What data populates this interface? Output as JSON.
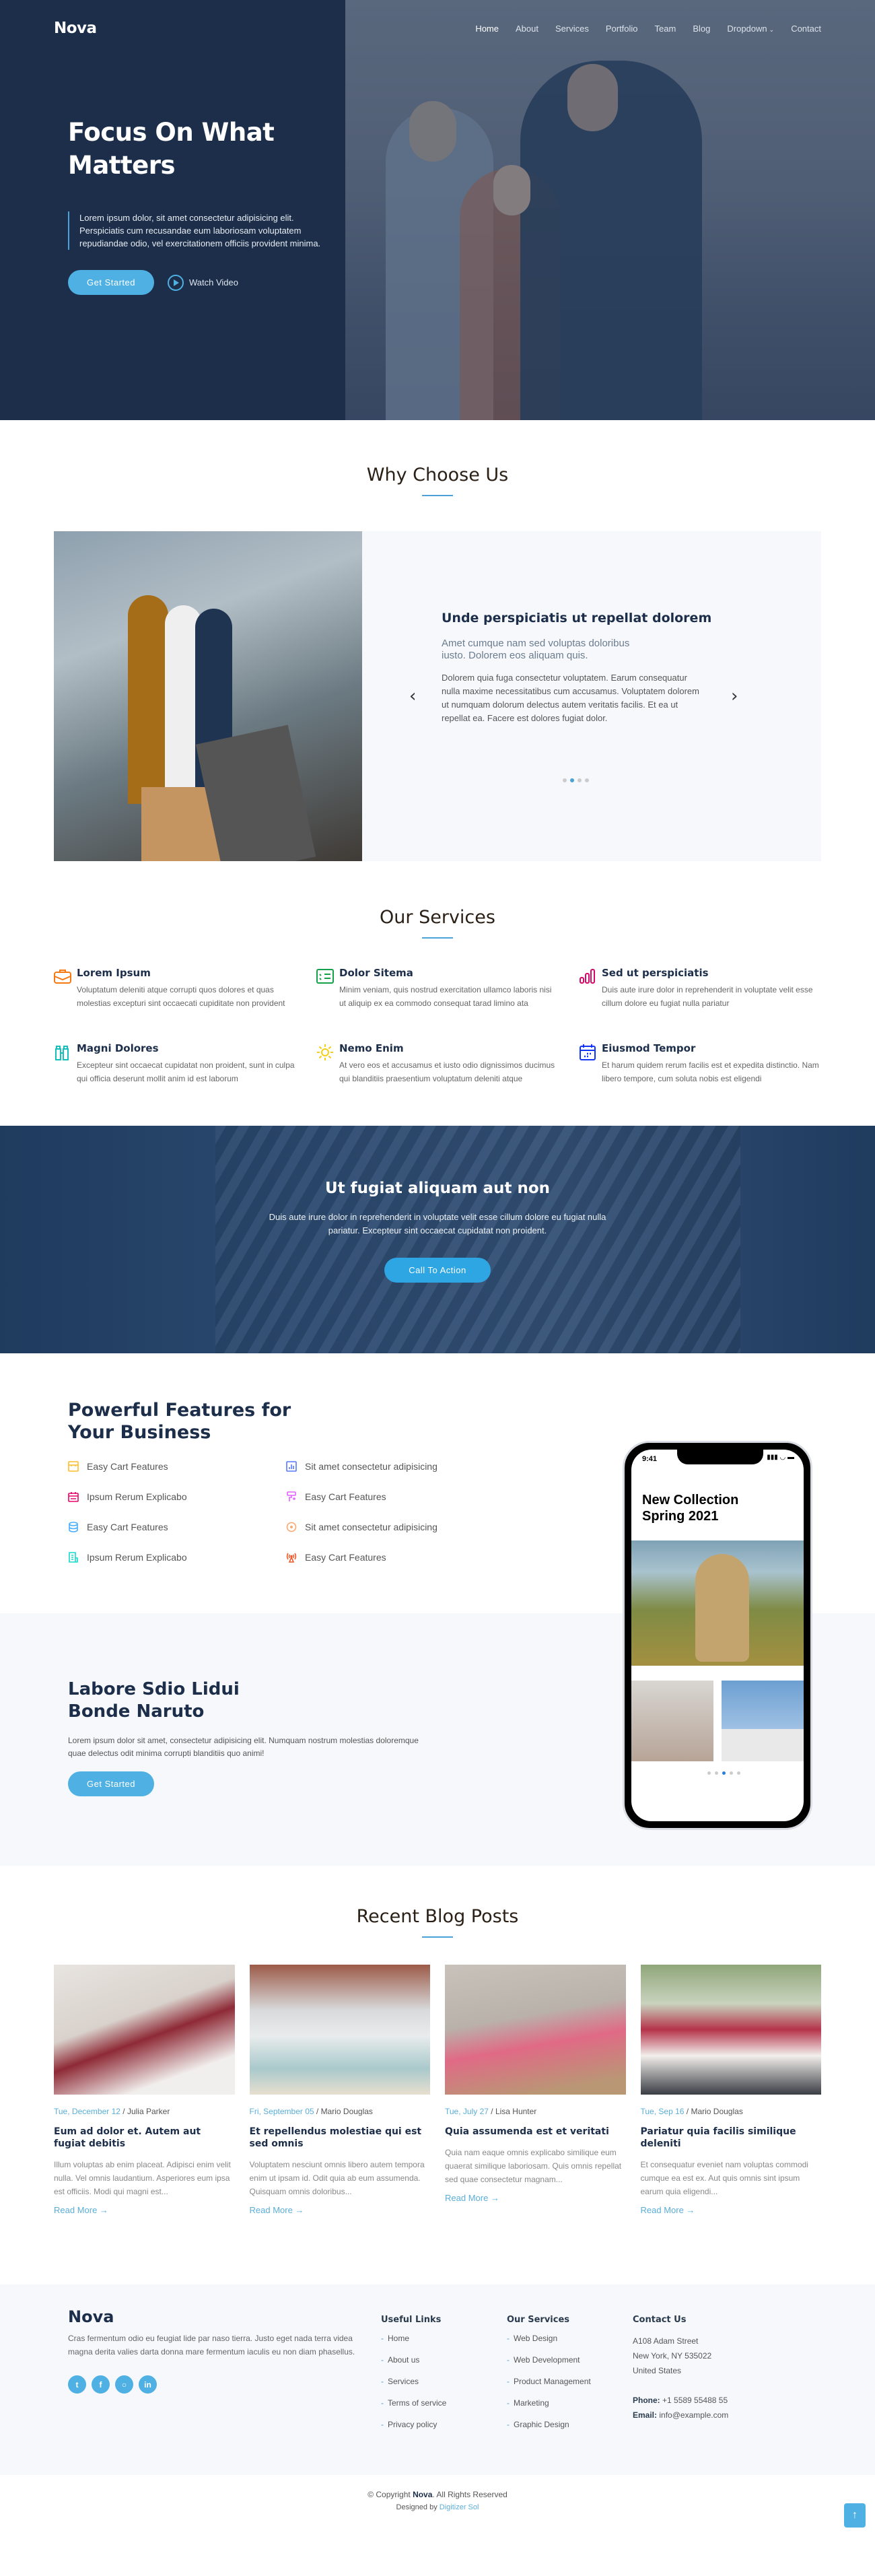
{
  "header": {
    "logo": "Nova",
    "nav": [
      {
        "label": "Home",
        "active": true
      },
      {
        "label": "About"
      },
      {
        "label": "Services"
      },
      {
        "label": "Portfolio"
      },
      {
        "label": "Team"
      },
      {
        "label": "Blog"
      },
      {
        "label": "Dropdown",
        "has_chevron": true
      },
      {
        "label": "Contact"
      }
    ]
  },
  "hero": {
    "title": "Focus On What Matters",
    "text": "Lorem ipsum dolor, sit amet consectetur adipisicing elit. Perspiciatis cum recusandae eum laboriosam voluptatem repudiandae odio, vel exercitationem officiis provident minima.",
    "cta_label": "Get Started",
    "video_label": "Watch Video"
  },
  "why": {
    "title": "Why Choose Us",
    "slide_title": "Unde perspiciatis ut repellat dolorem",
    "slide_subtitle": "Amet cumque nam sed voluptas doloribus iusto. Dolorem eos aliquam quis.",
    "slide_body": "Dolorem quia fuga consectetur voluptatem. Earum consequatur nulla maxime necessitatibus cum accusamus. Voluptatem dolorem ut numquam dolorum delectus autem veritatis facilis. Et ea ut repellat ea. Facere est dolores fugiat dolor.",
    "slide_count": 4,
    "active_slide": 2,
    "prev_icon": "chevron-left-icon",
    "next_icon": "chevron-right-icon"
  },
  "services": {
    "title": "Our Services",
    "items": [
      {
        "icon": "briefcase-icon",
        "color": "#f57813",
        "title": "Lorem Ipsum",
        "text": "Voluptatum deleniti atque corrupti quos dolores et quas molestias excepturi sint occaecati cupiditate non provident"
      },
      {
        "icon": "checklist-icon",
        "color": "#15a04a",
        "title": "Dolor Sitema",
        "text": "Minim veniam, quis nostrud exercitation ullamco laboris nisi ut aliquip ex ea commodo consequat tarad limino ata"
      },
      {
        "icon": "bar-chart-icon",
        "color": "#d90769",
        "title": "Sed ut perspiciatis",
        "text": "Duis aute irure dolor in reprehenderit in voluptate velit esse cillum dolore eu fugiat nulla pariatur"
      },
      {
        "icon": "binoculars-icon",
        "color": "#15bfbc",
        "title": "Magni Dolores",
        "text": "Excepteur sint occaecat cupidatat non proident, sunt in culpa qui officia deserunt mollit anim id est laborum"
      },
      {
        "icon": "sun-icon",
        "color": "#f5cf13",
        "title": "Nemo Enim",
        "text": "At vero eos et accusamus et iusto odio dignissimos ducimus qui blanditiis praesentium voluptatum deleniti atque"
      },
      {
        "icon": "calendar-icon",
        "color": "#1335f5",
        "title": "Eiusmod Tempor",
        "text": "Et harum quidem rerum facilis est et expedita distinctio. Nam libero tempore, cum soluta nobis est eligendi"
      }
    ]
  },
  "cta": {
    "title": "Ut fugiat aliquam aut non",
    "text": "Duis aute irure dolor in reprehenderit in voluptate velit esse cillum dolore eu fugiat nulla pariatur. Excepteur sint occaecat cupidatat non proident.",
    "button": "Call To Action"
  },
  "features": {
    "title": "Powerful Features for Your Business",
    "items": [
      {
        "icon": "store-icon",
        "color": "#ffbb2c",
        "label": "Easy Cart Features"
      },
      {
        "icon": "chart-box-icon",
        "color": "#5578ff",
        "label": "Sit amet consectetur adipisicing"
      },
      {
        "icon": "calendar-todo-icon",
        "color": "#e80368",
        "label": "Ipsum Rerum Explicabo"
      },
      {
        "icon": "paint-brush-icon",
        "color": "#e361ff",
        "label": "Easy Cart Features"
      },
      {
        "icon": "database-icon",
        "color": "#47aeff",
        "label": "Easy Cart Features"
      },
      {
        "icon": "target-icon",
        "color": "#ffa76e",
        "label": "Sit amet consectetur adipisicing"
      },
      {
        "icon": "document-icon",
        "color": "#11dbcf",
        "label": "Ipsum Rerum Explicabo"
      },
      {
        "icon": "broadcast-icon",
        "color": "#f1592a",
        "label": "Easy Cart Features"
      }
    ]
  },
  "labore": {
    "title": "Labore Sdio Lidui Bonde Naruto",
    "text": "Lorem ipsum dolor sit amet, consectetur adipisicing elit. Numquam nostrum molestias doloremque quae delectus odit minima corrupti blanditiis quo animi!",
    "button": "Get Started"
  },
  "phone": {
    "time": "9:41",
    "title": "New Collection Spring 2021",
    "dot_count": 5,
    "active_dot": 3
  },
  "blog": {
    "title": "Recent Blog Posts",
    "posts": [
      {
        "date": "Tue, December 12",
        "author": "Julia Parker",
        "title": "Eum ad dolor et. Autem aut fugiat debitis",
        "excerpt": "Illum voluptas ab enim placeat. Adipisci enim velit nulla. Vel omnis laudantium. Asperiores eum ipsa est officiis. Modi qui magni est...",
        "more": "Read More →"
      },
      {
        "date": "Fri, September 05",
        "author": "Mario Douglas",
        "title": "Et repellendus molestiae qui est sed omnis",
        "excerpt": "Voluptatem nesciunt omnis libero autem tempora enim ut ipsam id. Odit quia ab eum assumenda. Quisquam omnis doloribus...",
        "more": "Read More →"
      },
      {
        "date": "Tue, July 27",
        "author": "Lisa Hunter",
        "title": "Quia assumenda est et veritati",
        "excerpt": "Quia nam eaque omnis explicabo similique eum quaerat similique laboriosam. Quis omnis repellat sed quae consectetur magnam...",
        "more": "Read More →"
      },
      {
        "date": "Tue, Sep 16",
        "author": "Mario Douglas",
        "title": "Pariatur quia facilis similique deleniti",
        "excerpt": "Et consequatur eveniet nam voluptas commodi cumque ea est ex. Aut quis omnis sint ipsum earum quia eligendi...",
        "more": "Read More →"
      }
    ]
  },
  "footer": {
    "logo": "Nova",
    "about": "Cras fermentum odio eu feugiat lide par naso tierra. Justo eget nada terra videa magna derita valies darta donna mare fermentum iaculis eu non diam phasellus.",
    "social": [
      "twitter-icon",
      "facebook-icon",
      "instagram-icon",
      "linkedin-icon"
    ],
    "useful_title": "Useful Links",
    "useful": [
      "Home",
      "About us",
      "Services",
      "Terms of service",
      "Privacy policy"
    ],
    "services_title": "Our Services",
    "services": [
      "Web Design",
      "Web Development",
      "Product Management",
      "Marketing",
      "Graphic Design"
    ],
    "contact_title": "Contact Us",
    "address1": "A108 Adam Street",
    "address2": "New York, NY 535022",
    "address3": "United States",
    "phone_label": "Phone:",
    "phone": "+1 5589 55488 55",
    "email_label": "Email:",
    "email": "info@example.com",
    "copyright_pre": "© Copyright ",
    "copyright_brand": "Nova",
    "copyright_post": ". All Rights Reserved",
    "designed_pre": "Designed by ",
    "designed_brand": "Digitizer Sol"
  }
}
